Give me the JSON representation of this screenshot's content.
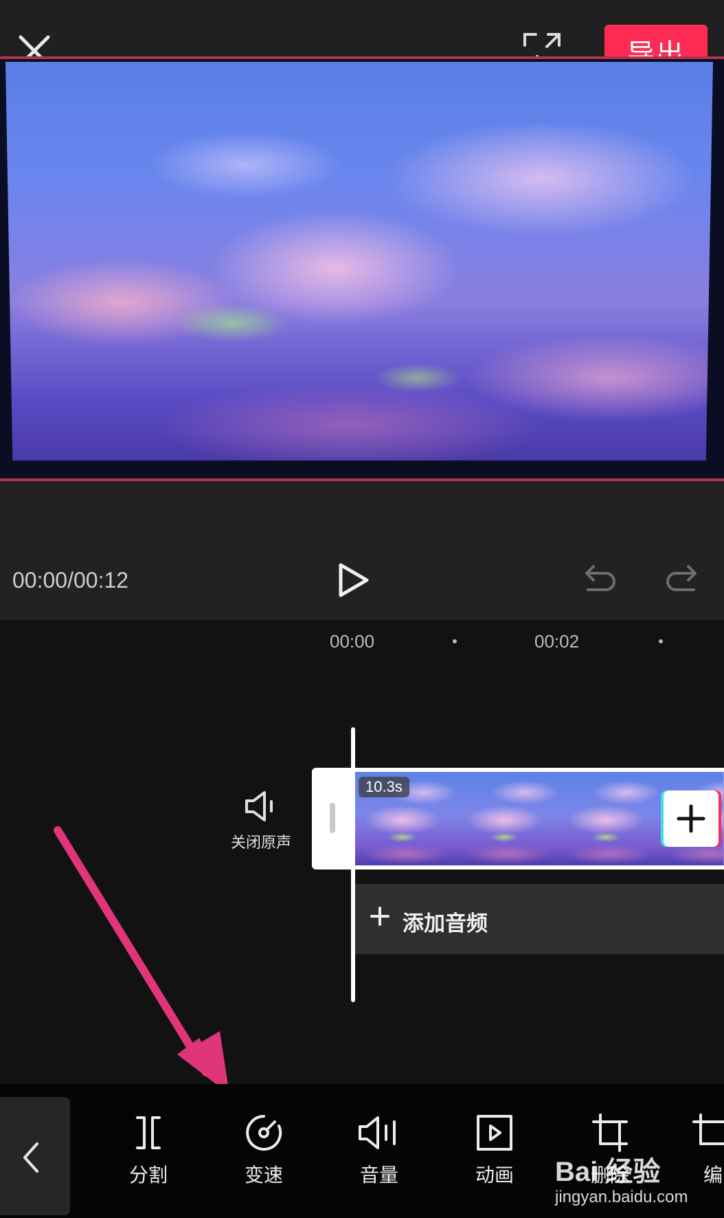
{
  "header": {
    "export_label": "导出"
  },
  "preview": {
    "image_desc_icon": "sky-clouds-video-frame"
  },
  "playback": {
    "time": "00:00/00:12"
  },
  "timeline": {
    "ruler": [
      "00:00",
      "00:02"
    ],
    "mute_label": "关闭原声",
    "clip_duration": "10.3s",
    "add_audio_label": "添加音频"
  },
  "toolbar": {
    "items": [
      {
        "label": "分割",
        "icon": "split-icon"
      },
      {
        "label": "变速",
        "icon": "speed-icon"
      },
      {
        "label": "音量",
        "icon": "volume-icon"
      },
      {
        "label": "动画",
        "icon": "animation-icon"
      },
      {
        "label": "删除",
        "icon": "delete-icon"
      },
      {
        "label": "编",
        "icon": "edit-icon"
      }
    ]
  },
  "watermark": {
    "logo": "Bai 经验",
    "url": "jingyan.baidu.com"
  },
  "colors": {
    "accent": "#fe2c55",
    "annotation_arrow": "#e0357a"
  }
}
